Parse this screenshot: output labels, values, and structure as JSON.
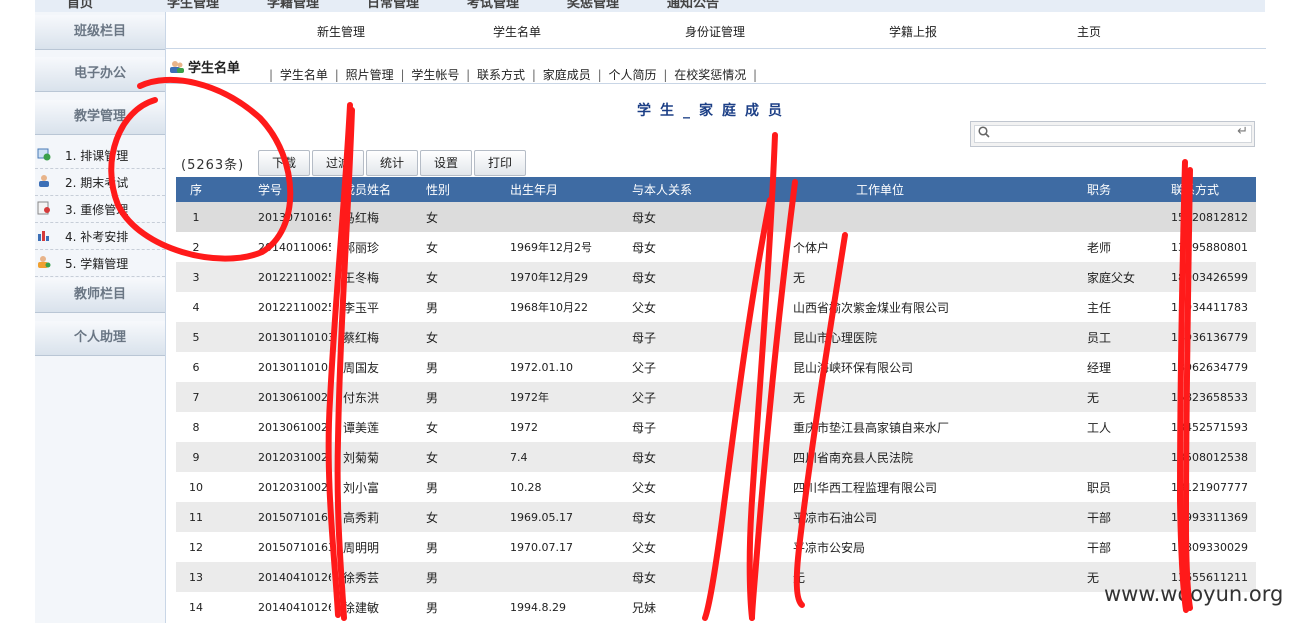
{
  "top_nav": [
    "首页",
    "学生管理",
    "学籍管理",
    "日常管理",
    "考试管理",
    "奖惩管理",
    "通知公告"
  ],
  "sidebar": {
    "sections": [
      {
        "label": "班级栏目"
      },
      {
        "label": "电子办公"
      },
      {
        "label": "教学管理"
      },
      {
        "label": "教师栏目"
      },
      {
        "label": "个人助理"
      }
    ],
    "items": [
      {
        "label": "1. 排课管理",
        "icon": "schedule-icon"
      },
      {
        "label": "2. 期末考试",
        "icon": "exam-icon"
      },
      {
        "label": "3. 重修管理",
        "icon": "retake-icon"
      },
      {
        "label": "4. 补考安排",
        "icon": "chart-icon"
      },
      {
        "label": "5. 学籍管理",
        "icon": "user-icon"
      }
    ]
  },
  "menu": [
    "新生管理",
    "学生名单",
    "身份证管理",
    "学籍上报",
    "主页"
  ],
  "section_title": "学生名单",
  "subtabs": [
    "学生名单",
    "照片管理",
    "学生帐号",
    "联系方式",
    "家庭成员",
    "个人简历",
    "在校奖惩情况"
  ],
  "page_heading": "学生_家庭成员",
  "search": {
    "placeholder": "",
    "enter_icon": "↵"
  },
  "record_count": "(5263条)",
  "buttons": [
    "下载",
    "过滤",
    "统计",
    "设置",
    "打印"
  ],
  "table": {
    "columns": [
      "序",
      "学号",
      "成员姓名",
      "性别",
      "出生年月",
      "与本人关系",
      "工作单位",
      "职务",
      "联系方式"
    ],
    "rows": [
      [
        "1",
        "20130710165",
        "马红梅",
        "女",
        "",
        "母女",
        "",
        "",
        "15920812812"
      ],
      [
        "2",
        "20140110065",
        "郝丽珍",
        "女",
        "1969年12月2号",
        "母女",
        "个体户",
        "老师",
        "13795880801"
      ],
      [
        "3",
        "20122110025",
        "王冬梅",
        "女",
        "1970年12月29",
        "母女",
        "无",
        "家庭父女",
        "18003426599"
      ],
      [
        "4",
        "20122110025",
        "李玉平",
        "男",
        "1968年10月22",
        "父女",
        "山西省榆次紫金煤业有限公司",
        "主任",
        "13934411783"
      ],
      [
        "5",
        "20130110103",
        "蔡红梅",
        "女",
        "",
        "母子",
        "昆山市心理医院",
        "员工",
        "18936136779"
      ],
      [
        "6",
        "20130110103",
        "周国友",
        "男",
        "1972.01.10",
        "父子",
        "昆山海峡环保有限公司",
        "经理",
        "18962634779"
      ],
      [
        "7",
        "20130610028",
        "付东洪",
        "男",
        "1972年",
        "父子",
        "无",
        "无",
        "15823658533"
      ],
      [
        "8",
        "20130610028",
        "谭美莲",
        "女",
        "1972",
        "母子",
        "重庆市垫江县高家镇自来水厂",
        "工人",
        "13452571593"
      ],
      [
        "9",
        "20120310023",
        "刘菊菊",
        "女",
        "7.4",
        "母女",
        "四川省南充县人民法院",
        "",
        "13508012538"
      ],
      [
        "10",
        "20120310023",
        "刘小富",
        "男",
        "10.28",
        "父女",
        "四川华西工程监理有限公司",
        "职员",
        "18121907777"
      ],
      [
        "11",
        "20150710163",
        "高秀莉",
        "女",
        "1969.05.17",
        "母女",
        "平凉市石油公司",
        "干部",
        "13993311369"
      ],
      [
        "12",
        "20150710163",
        "周明明",
        "男",
        "1970.07.17",
        "父女",
        "平凉市公安局",
        "干部",
        "18809330029"
      ],
      [
        "13",
        "20140410126",
        "徐秀芸",
        "男",
        "",
        "母女",
        "无",
        "无",
        "13655611211"
      ],
      [
        "14",
        "20140410126",
        "徐建敏",
        "男",
        "1994.8.29",
        "兄妹",
        "",
        "",
        ""
      ]
    ]
  },
  "watermark": "www.wooyun.org"
}
